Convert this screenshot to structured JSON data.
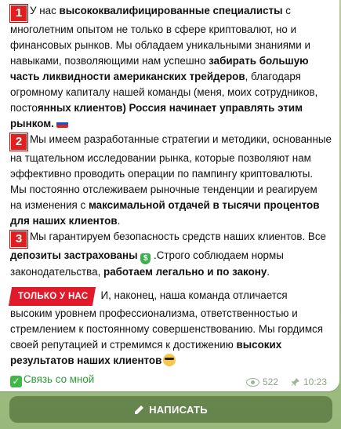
{
  "message": {
    "p1": {
      "num": "1",
      "t1": "У нас ",
      "b1": "высококвалифицированные специалисты",
      "t2": " с многолетним опытом не только в сфере криптовалют, но и финансовых рынков. Мы обладаем уникальными знаниями и навыками, позволяющими нам успешно ",
      "b2": "забирать большую часть ликвидности американских трейдеров",
      "t3": ", благодаря огромному капиталу нашей команды (меня, моих сотрудников, посто",
      "b3": "янных клиентов) Россия начинает управлять этим рынком.",
      "flag": "russia-flag"
    },
    "p2": {
      "num": "2",
      "t1": "Мы имеем разработанные стратегии и методики, основанные на тщательном исследовании рынка, которые позволяют нам эффективно проводить операции по пампингу криптовалюты. Мы постоянно отслеживаем рыночные тенденции и реагируем на изменения с ",
      "b1": "максимальной отдачей в тысячи процентов для наших клиентов",
      "t2": "."
    },
    "p3": {
      "num": "3",
      "t1": "Мы гарантируем безопасность средств наших клиентов. Все ",
      "b1": "депозиты застрахованы",
      "t2": " .Строго соблюдаем нормы законодательства, ",
      "b2": "работаем легально и по закону",
      "t3": "."
    },
    "p4": {
      "badge": "ТОЛЬКО У НАС",
      "t1": "И, наконец, наша команда отличается высоким уровнем профессионализма, ответственностью и стремлением к постоянному совершенствованию. Мы гордимся своей репутацией и стремимся к достижению ",
      "b1": "высоких результатов наших клиентов"
    },
    "contact_link": "Связь со мной",
    "views": "522",
    "time": "10:23"
  },
  "write_button": "НАПИСАТЬ",
  "colors": {
    "accent_red": "#e0201f",
    "link_green": "#2e9b3a",
    "bubble": "#ffffff",
    "background": "#a9c58e"
  }
}
